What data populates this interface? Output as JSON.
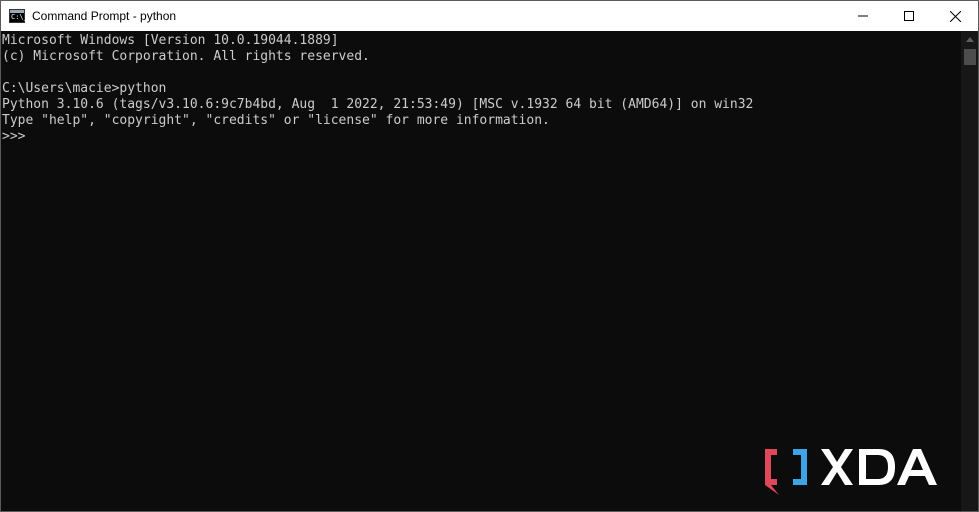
{
  "window": {
    "title": "Command Prompt - python",
    "icon_text": "C:\\_",
    "icon": "cmd-icon"
  },
  "controls": {
    "minimize": "minimize-icon",
    "maximize": "maximize-icon",
    "close": "close-icon"
  },
  "console": {
    "lines": [
      "Microsoft Windows [Version 10.0.19044.1889]",
      "(c) Microsoft Corporation. All rights reserved.",
      "",
      "C:\\Users\\macie>python",
      "Python 3.10.6 (tags/v3.10.6:9c7b4bd, Aug  1 2022, 21:53:49) [MSC v.1932 64 bit (AMD64)] on win32",
      "Type \"help\", \"copyright\", \"credits\" or \"license\" for more information.",
      ">>>"
    ],
    "text_color": "#cccccc",
    "background": "#0c0c0c"
  },
  "watermark": {
    "brand": "XDA",
    "bracket_color": "#e0475a",
    "bracket_color_2": "#3fa3e8",
    "text_color": "#ffffff"
  }
}
